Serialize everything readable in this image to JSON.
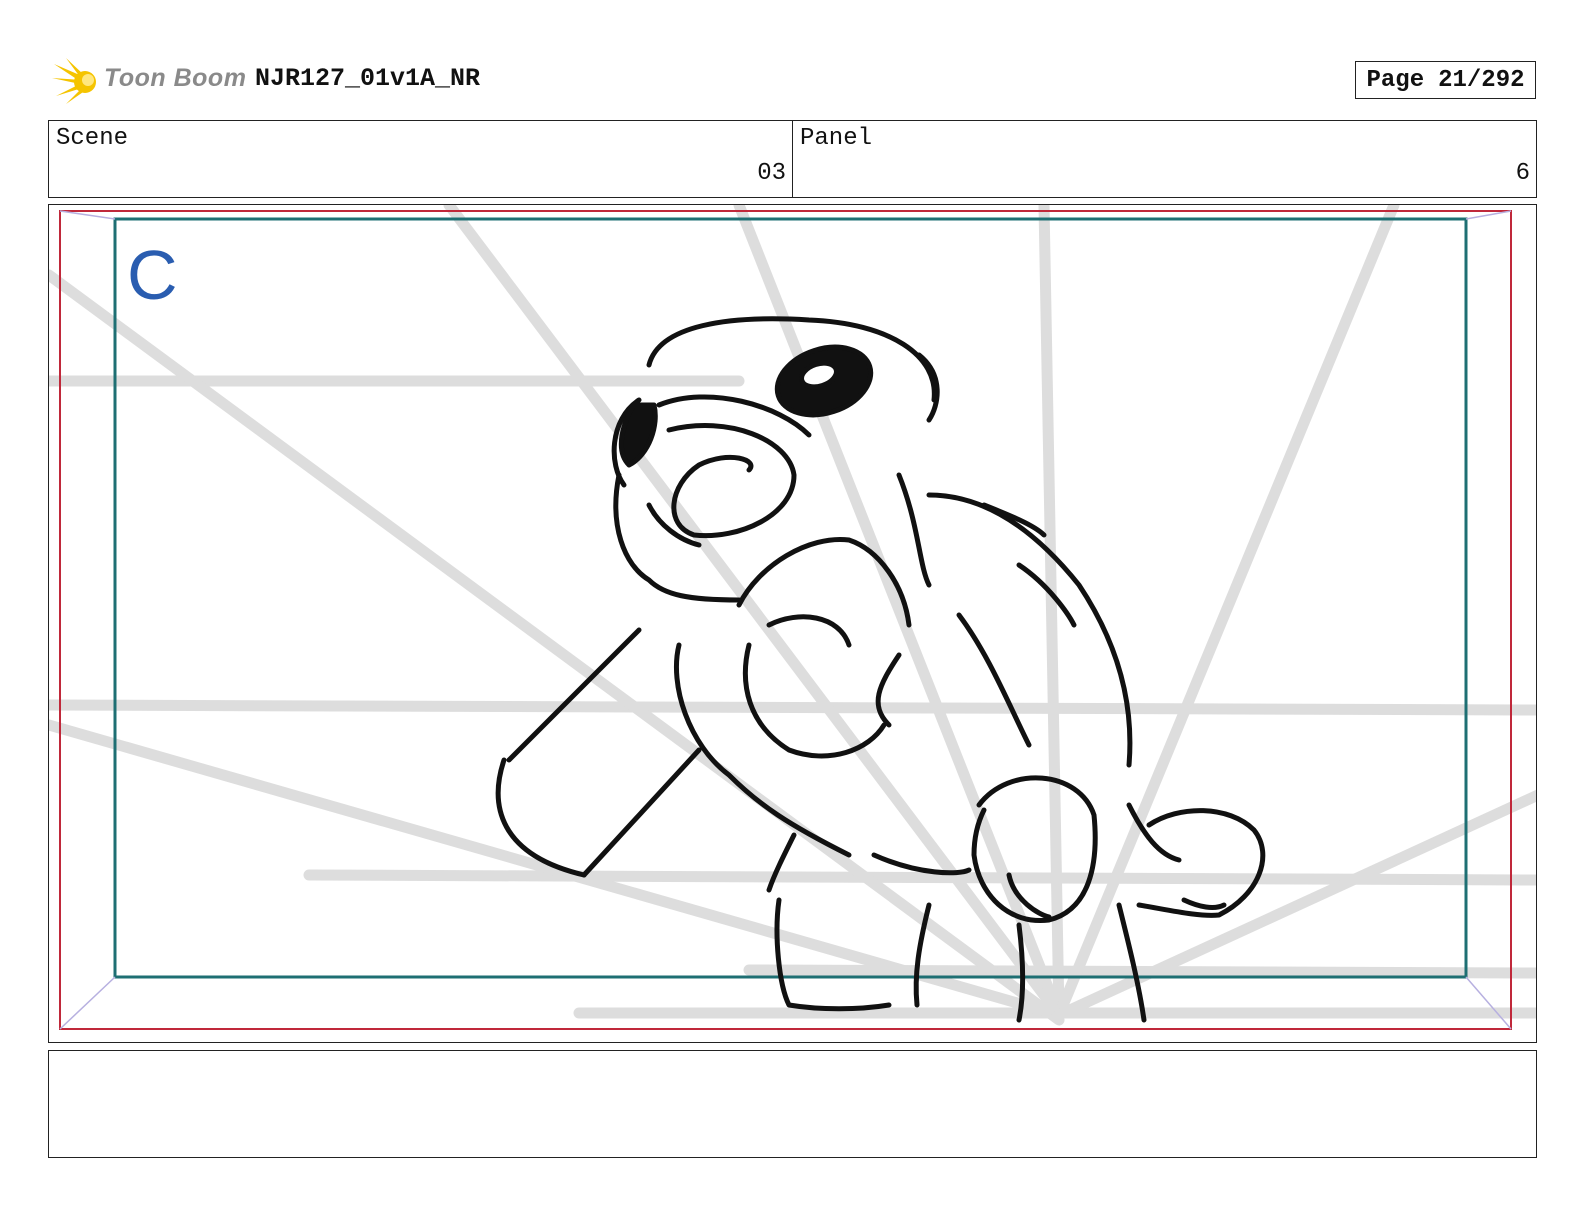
{
  "header": {
    "brand": "Toon Boom",
    "project_title": "NJR127_01v1A_NR",
    "page_label": "Page",
    "page_value": "21/292"
  },
  "info": {
    "scene_label": "Scene",
    "scene_value": "03",
    "panel_label": "Panel",
    "panel_value": "6"
  },
  "panel": {
    "camera_label": "C"
  },
  "colors": {
    "brand_yellow": "#f5c400",
    "frame_red": "#c0283a",
    "frame_teal": "#1e6f73",
    "camera_blue": "#2a5db0",
    "guide_gray": "#dddddd"
  },
  "icons": [
    "toon-boom-logo-icon"
  ]
}
